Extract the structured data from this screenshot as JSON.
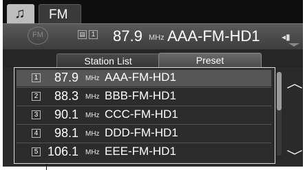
{
  "tabs": {
    "music_icon": "♫",
    "source_label": "FM"
  },
  "info": {
    "fm_icon_label": "FM",
    "frequency": "87.9",
    "unit": "MHz",
    "station": "AAA-FM-HD1",
    "signal_icon": "signal-icon",
    "icon_box_1": "1"
  },
  "view_tabs": {
    "station_list": "Station List",
    "preset": "Preset"
  },
  "presets": [
    {
      "num": "1",
      "freq": "87.9",
      "unit": "MHz",
      "name": "AAA-FM-HD1",
      "selected": true
    },
    {
      "num": "2",
      "freq": "88.3",
      "unit": "MHz",
      "name": "BBB-FM-HD1",
      "selected": false
    },
    {
      "num": "3",
      "freq": "90.1",
      "unit": "MHz",
      "name": "CCC-FM-HD1",
      "selected": false
    },
    {
      "num": "4",
      "freq": "98.1",
      "unit": "MHz",
      "name": "DDD-FM-HD1",
      "selected": false
    },
    {
      "num": "5",
      "freq": "106.1",
      "unit": "MHz",
      "name": "EEE-FM-HD1",
      "selected": false
    }
  ],
  "scroll": {
    "up_icon": "︿",
    "down_icon": "﹀"
  }
}
